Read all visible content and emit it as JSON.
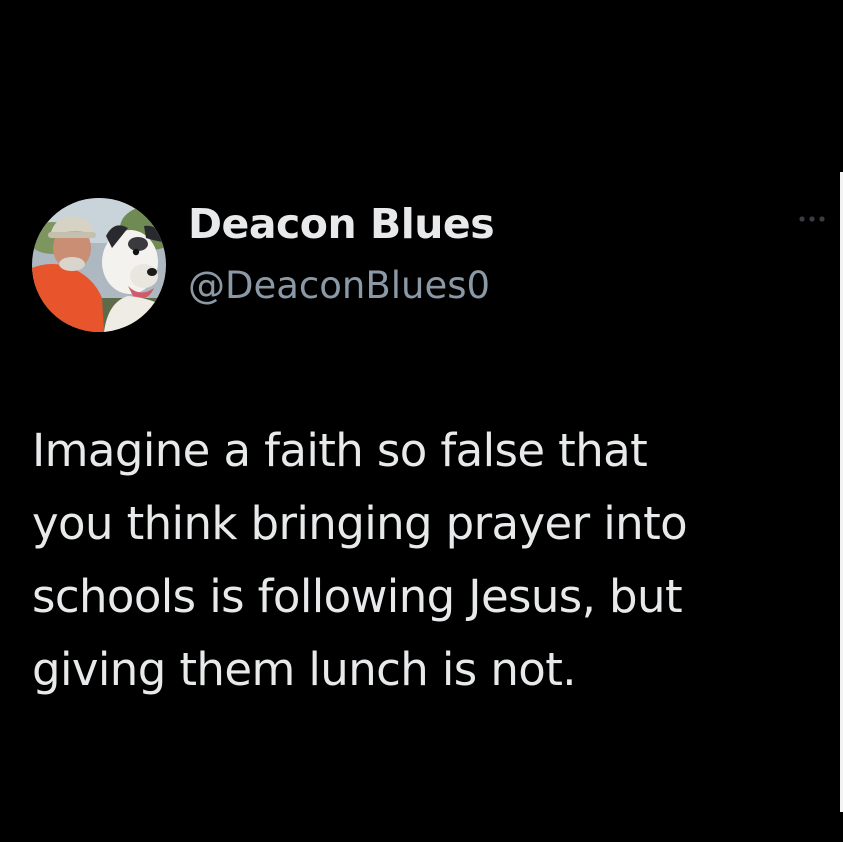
{
  "tweet": {
    "author": {
      "display_name": "Deacon Blues",
      "handle": "@DeaconBlues0"
    },
    "text_lines": [
      "Imagine a faith so false that",
      "you think bringing prayer into",
      "schools is following Jesus, but",
      "giving them lunch is not."
    ],
    "icons": {
      "more": "more-horizontal-icon"
    }
  },
  "colors": {
    "background": "#000000",
    "primary_text": "#e7e9ea",
    "secondary_text": "#8b98a5",
    "more_icon": "#3a3d42"
  }
}
